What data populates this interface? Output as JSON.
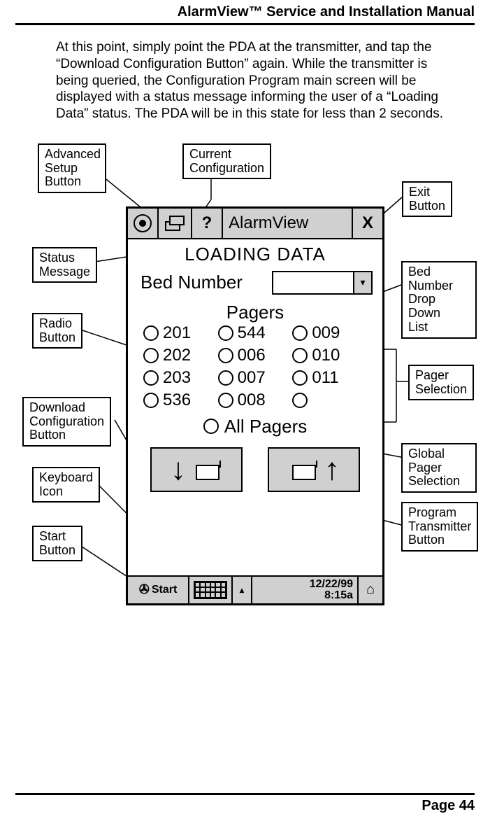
{
  "doc": {
    "header": "AlarmView™ Service and Installation Manual",
    "paragraph": "At this point, simply point the PDA at the transmitter, and tap the “Download Configuration Button” again.  While the transmitter is being queried, the Configuration Program main screen will be displayed with a status message informing the user of a “Loading Data” status.  The PDA will be in this state for less than 2 seconds.",
    "page_footer": "Page 44"
  },
  "pda": {
    "app_title": "AlarmView",
    "help_glyph": "?",
    "exit_glyph": "X",
    "adv_glyph": "⌨",
    "status": "LOADING DATA",
    "bed_label": "Bed Number",
    "pagers_title": "Pagers",
    "pagers": [
      [
        "201",
        "544",
        "009"
      ],
      [
        "202",
        "006",
        "010"
      ],
      [
        "203",
        "007",
        "011"
      ],
      [
        "536",
        "008",
        ""
      ]
    ],
    "all_pagers": "All Pagers",
    "taskbar": {
      "start": "Start",
      "clock_line1": "12/22/99",
      "clock_line2": "8:15a"
    }
  },
  "callouts": {
    "advanced": "Advanced\nSetup\nButton",
    "current_config": "Current\nConfiguration",
    "status_message": "Status\nMessage",
    "radio_button": "Radio\nButton",
    "download": "Download\nConfiguration\nButton",
    "keyboard": "Keyboard\nIcon",
    "start": "Start\nButton",
    "exit": "Exit\nButton",
    "bed_dd": "Bed Number\nDrop Down\nList",
    "pager_sel": "Pager\nSelection",
    "global_sel": "Global Pager\nSelection",
    "program_tx": "Program\nTransmitter\nButton"
  }
}
